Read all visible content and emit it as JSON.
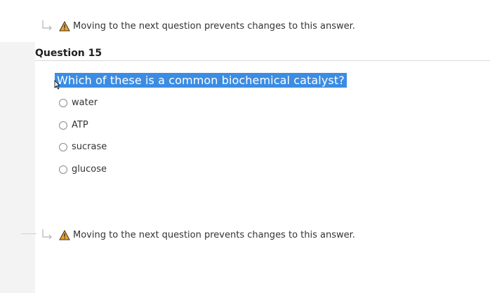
{
  "warnings": {
    "top_text": "Moving to the next question prevents changes to this answer.",
    "bottom_text": "Moving to the next question prevents changes to this answer."
  },
  "question": {
    "title": "Question 15",
    "text": "Which of these is a common biochemical catalyst?",
    "options": [
      "water",
      "ATP",
      "sucrase",
      "glucose"
    ]
  },
  "icons": {
    "warning": "warning-triangle-icon",
    "arrow": "return-arrow-icon",
    "cursor": "mouse-cursor-icon"
  },
  "colors": {
    "selection": "#3b8ce3",
    "warning": "#f0a020"
  }
}
